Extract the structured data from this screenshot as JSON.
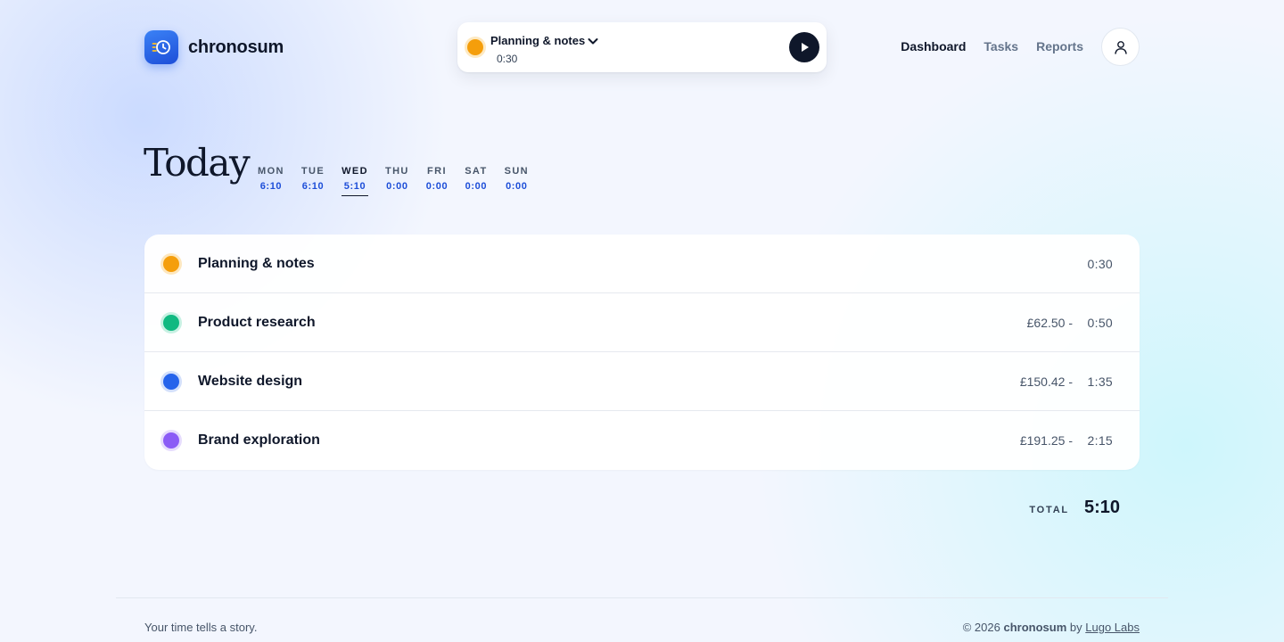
{
  "header": {
    "brand": "chronosum",
    "nav": [
      {
        "label": "Dashboard",
        "active": true
      },
      {
        "label": "Tasks",
        "active": false
      },
      {
        "label": "Reports",
        "active": false
      }
    ]
  },
  "timer": {
    "task_name": "Planning & notes",
    "elapsed": "0:30",
    "dot_color": "#f59e0b"
  },
  "main": {
    "title": "Today",
    "days": [
      {
        "name": "MON",
        "total": "6:10"
      },
      {
        "name": "TUE",
        "total": "6:10"
      },
      {
        "name": "WED",
        "total": "5:10",
        "active": true
      },
      {
        "name": "THU",
        "total": "0:00"
      },
      {
        "name": "FRI",
        "total": "0:00"
      },
      {
        "name": "SAT",
        "total": "0:00"
      },
      {
        "name": "SUN",
        "total": "0:00"
      }
    ],
    "entries": [
      {
        "name": "Planning & notes",
        "amount": "",
        "duration": "0:30",
        "color": "#f59e0b",
        "ring": "#fde7bf"
      },
      {
        "name": "Product research",
        "amount": "£62.50 -",
        "duration": "0:50",
        "color": "#10b981",
        "ring": "#c7f1e3"
      },
      {
        "name": "Website design",
        "amount": "£150.42 -",
        "duration": "1:35",
        "color": "#2563eb",
        "ring": "#d3e0fb"
      },
      {
        "name": "Brand exploration",
        "amount": "£191.25 -",
        "duration": "2:15",
        "color": "#8b5cf6",
        "ring": "#e6dcfd"
      }
    ],
    "total_label": "TOTAL",
    "total_value": "5:10"
  },
  "footer": {
    "tagline": "Your time tells a story.",
    "copyright": "© 2026",
    "brand": "chronosum",
    "by": "by",
    "company": "Lugo Labs"
  },
  "icons": {
    "logo": "clock-history-icon",
    "chevron": "chevron-down-icon",
    "play": "play-icon",
    "user": "user-icon"
  }
}
